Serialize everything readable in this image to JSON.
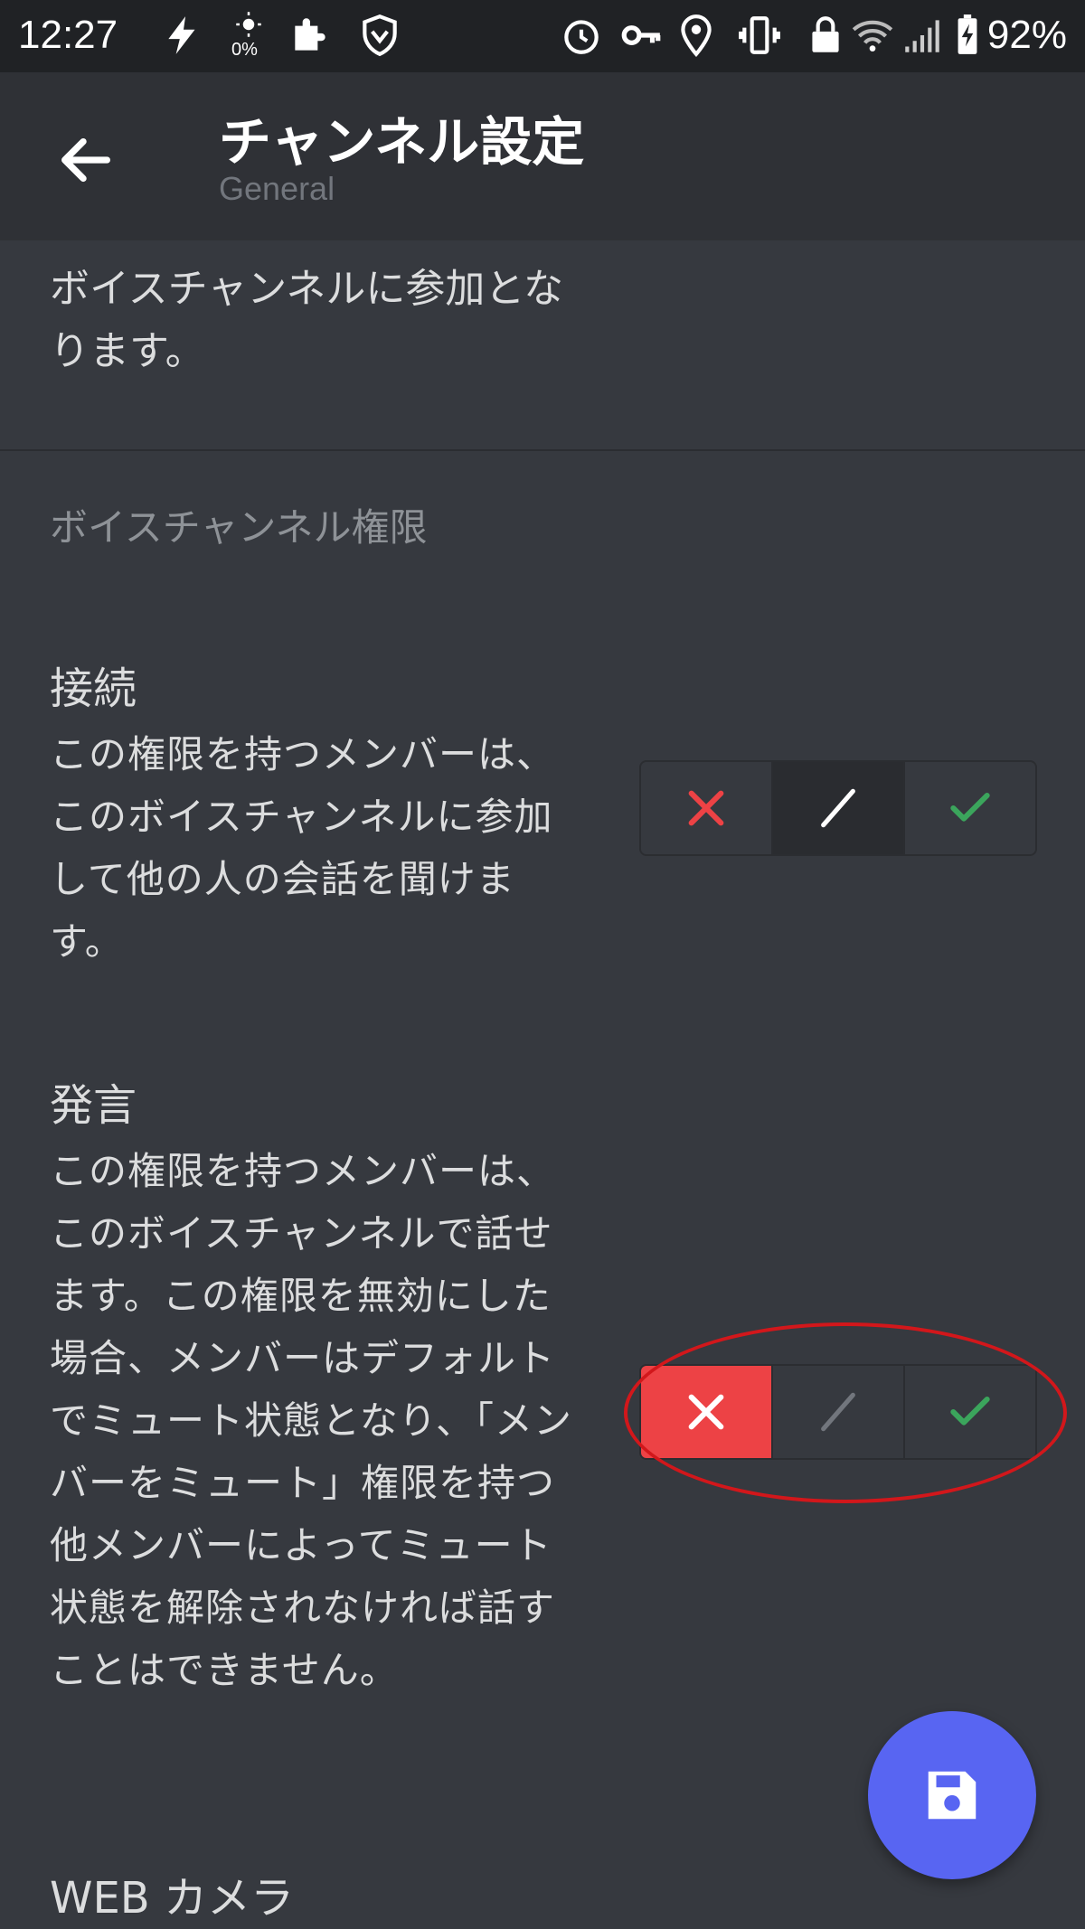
{
  "status_bar": {
    "time": "12:27",
    "brightness_percent": "0%",
    "battery": "92%",
    "icons": [
      "flash-icon",
      "brightness-icon",
      "puzzle-icon",
      "shield-icon",
      "alarm-icon",
      "key-icon",
      "location-icon",
      "vibrate-icon",
      "lock-icon",
      "wifi-icon",
      "signal-icon",
      "battery-icon"
    ]
  },
  "toolbar": {
    "title": "チャンネル設定",
    "subtitle": "General"
  },
  "content": {
    "partial_description": "ボイスチャンネルに参加となります。",
    "section_header": "ボイスチャンネル権限",
    "permissions": [
      {
        "title": "接続",
        "description": "この権限を持つメンバーは、このボイスチャンネルに参加して他の人の会話を聞けます。",
        "state": "neutral"
      },
      {
        "title": "発言",
        "description": "この権限を持つメンバーは、このボイスチャンネルで話せます。この権限を無効にした場合、メンバーはデフォルトでミュート状態となり、「メンバーをミュート」権限を持つ他メンバーによってミュート状態を解除されなければ話すことはできません。",
        "state": "deny"
      },
      {
        "title": "WEB カメラ"
      }
    ]
  },
  "colors": {
    "background": "#36393f",
    "toolbar": "#2f3136",
    "deny_red": "#ed4245",
    "allow_green": "#3ba55c",
    "fab_blurple": "#5865f2",
    "highlight_red": "#d2171b"
  },
  "fab": {
    "icon": "save-icon"
  }
}
